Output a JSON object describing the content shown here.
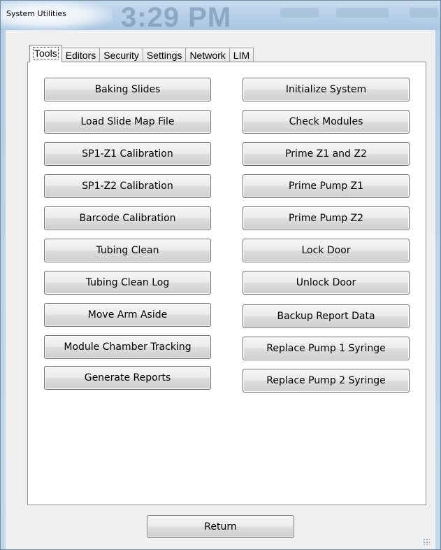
{
  "window": {
    "title": "System Utilities",
    "background_clock": "3:29 PM"
  },
  "tabs": [
    {
      "label": "Tools",
      "active": true
    },
    {
      "label": "Editors",
      "active": false
    },
    {
      "label": "Security",
      "active": false
    },
    {
      "label": "Settings",
      "active": false
    },
    {
      "label": "Network",
      "active": false
    },
    {
      "label": "LIM",
      "active": false
    }
  ],
  "tools": {
    "left_buttons": [
      "Baking Slides",
      "Load Slide Map File",
      "SP1-Z1 Calibration",
      "SP1-Z2 Calibration",
      "Barcode Calibration",
      "Tubing Clean",
      "Tubing Clean Log",
      "Move Arm Aside",
      "Module Chamber Tracking",
      "Generate Reports"
    ],
    "right_buttons": [
      "Initialize System",
      "Check Modules",
      "Prime Z1 and Z2",
      "Prime Pump Z1",
      "Prime Pump Z2",
      "Lock Door",
      "Unlock Door",
      "Backup Report Data",
      "Replace Pump 1 Syringe",
      "Replace Pump 2 Syringe"
    ]
  },
  "footer": {
    "return_label": "Return"
  },
  "colors": {
    "titlebar": "#b7d0e8",
    "client_bg": "#f0f0f0",
    "panel_bg": "#ffffff"
  }
}
